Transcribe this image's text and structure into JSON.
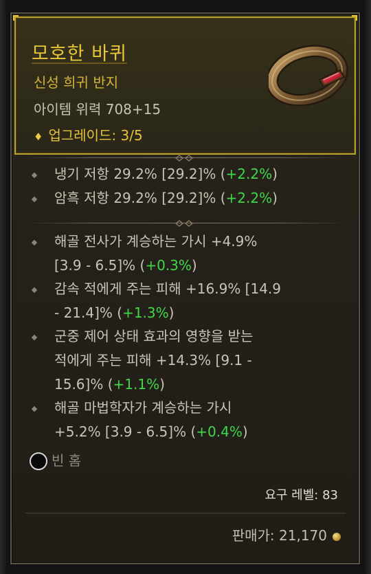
{
  "item": {
    "name": "모호한 바퀴",
    "type": "신성 희귀 반지",
    "power": "아이템 위력 708+15",
    "upgrade_icon": "diamond-icon",
    "upgrade": "업그레이드: 3/5"
  },
  "implicit_affixes": [
    {
      "text": "냉기 저항 29.2% [29.2]% (",
      "bonus": "+2.2%",
      "close": ")"
    },
    {
      "text": "암흑 저항 29.2% [29.2]% (",
      "bonus": "+2.2%",
      "close": ")"
    }
  ],
  "affixes": [
    {
      "lines": [
        "해골 전사가 계승하는 가시 +4.9%"
      ],
      "last": "[3.9 - 6.5]% (",
      "bonus": "+0.3%",
      "close": ")"
    },
    {
      "lines": [
        "감속 적에게 주는 피해 +16.9% [14.9"
      ],
      "last": "- 21.4]% (",
      "bonus": "+1.3%",
      "close": ")"
    },
    {
      "lines": [
        "군중 제어 상태 효과의 영향을 받는",
        "적에게 주는 피해 +14.3% [9.1 -"
      ],
      "last": "15.6]% (",
      "bonus": "+1.1%",
      "close": ")"
    },
    {
      "lines": [
        "해골 마법학자가 계승하는 가시"
      ],
      "last": "+5.2% [3.9 - 6.5]% (",
      "bonus": "+0.4%",
      "close": ")"
    }
  ],
  "socket": {
    "label": "빈 홈",
    "icon": "empty-socket-icon"
  },
  "requirement": "요구 레벨: 83",
  "sell_value": "판매가: 21,170",
  "colors": {
    "legendary_gold": "#e8c63a",
    "bonus_green": "#3fd84a",
    "frame_gold": "#b9a12a"
  }
}
